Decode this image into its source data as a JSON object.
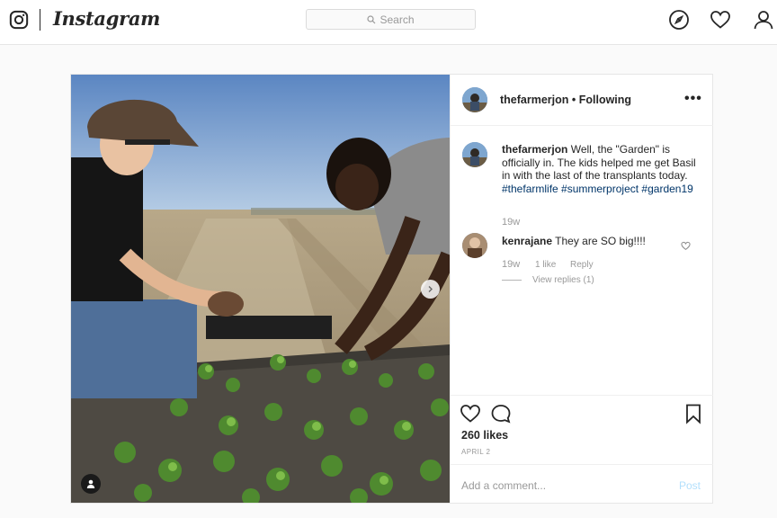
{
  "header": {
    "wordmark": "Instagram",
    "search_placeholder": "Search",
    "icons": [
      "instagram-glyph-icon",
      "compass-icon",
      "heart-icon",
      "profile-icon"
    ]
  },
  "post": {
    "author": "thefarmerjon",
    "follow_status": "Following",
    "author_line": "thefarmerjon • Following",
    "more_label": "•••",
    "caption": {
      "username": "thefarmerjon",
      "text": "Well, the \"Garden\" is officially in. The kids helped me get Basil in with the last of the transplants today.",
      "hashtags": [
        "#thefarmlife",
        "#summerproject",
        "#garden19"
      ],
      "age": "19w"
    },
    "comments": [
      {
        "username": "kenrajane",
        "text": "They are SO big!!!!",
        "age": "19w",
        "likes": "1 like",
        "reply_label": "Reply",
        "view_replies": "View replies (1)"
      }
    ],
    "likes": "260 likes",
    "date": "APRIL 2",
    "add_comment_placeholder": "Add a comment...",
    "post_button": "Post"
  },
  "colors": {
    "hashtag": "#003569",
    "muted": "#999999",
    "post_disabled": "#b2dffc"
  }
}
